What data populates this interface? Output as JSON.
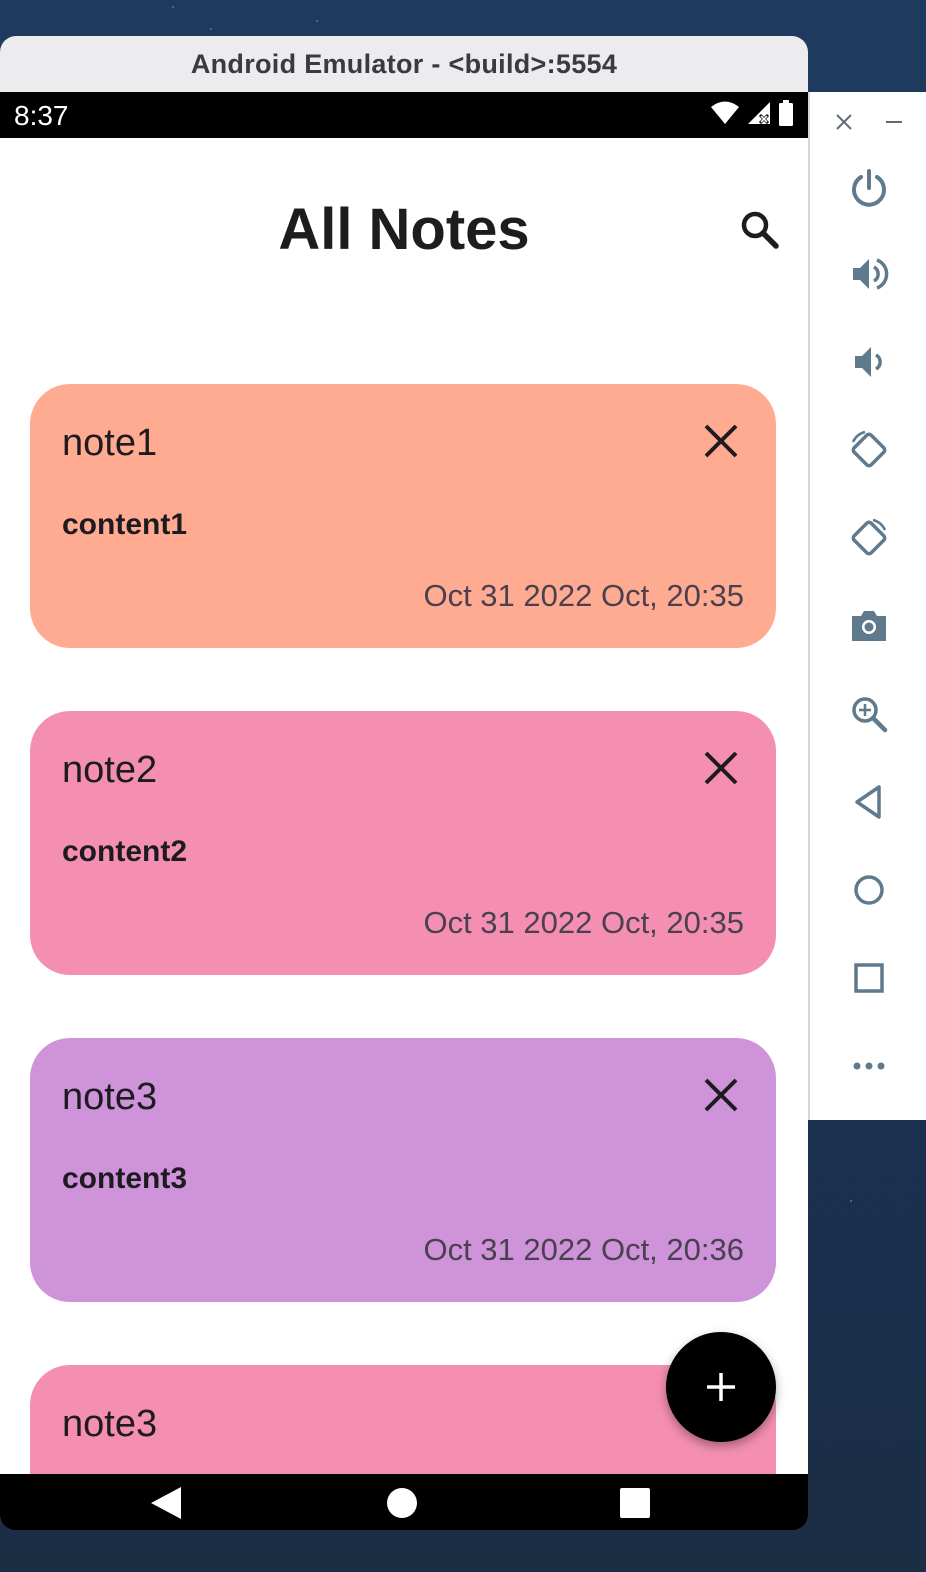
{
  "emulator": {
    "window_title": "Android Emulator - <build>:5554"
  },
  "status_bar": {
    "time": "8:37"
  },
  "app": {
    "title": "All Notes",
    "notes": [
      {
        "title": "note1",
        "content": "content1",
        "date": "Oct 31 2022 Oct, 20:35",
        "color": "#ffab91"
      },
      {
        "title": "note2",
        "content": "content2",
        "date": "Oct 31 2022 Oct, 20:35",
        "color": "#f48fb1"
      },
      {
        "title": "note3",
        "content": "content3",
        "date": "Oct 31 2022 Oct, 20:36",
        "color": "#ce93d8"
      },
      {
        "title": "note3",
        "content": "",
        "date": "",
        "color": "#f48fb1"
      }
    ],
    "fab_icon": "plus-icon"
  },
  "sidebar": {
    "buttons": [
      "power-icon",
      "volume-up-icon",
      "volume-down-icon",
      "rotate-left-icon",
      "rotate-right-icon",
      "camera-icon",
      "zoom-icon",
      "back-icon",
      "home-icon",
      "overview-icon",
      "more-icon"
    ]
  }
}
